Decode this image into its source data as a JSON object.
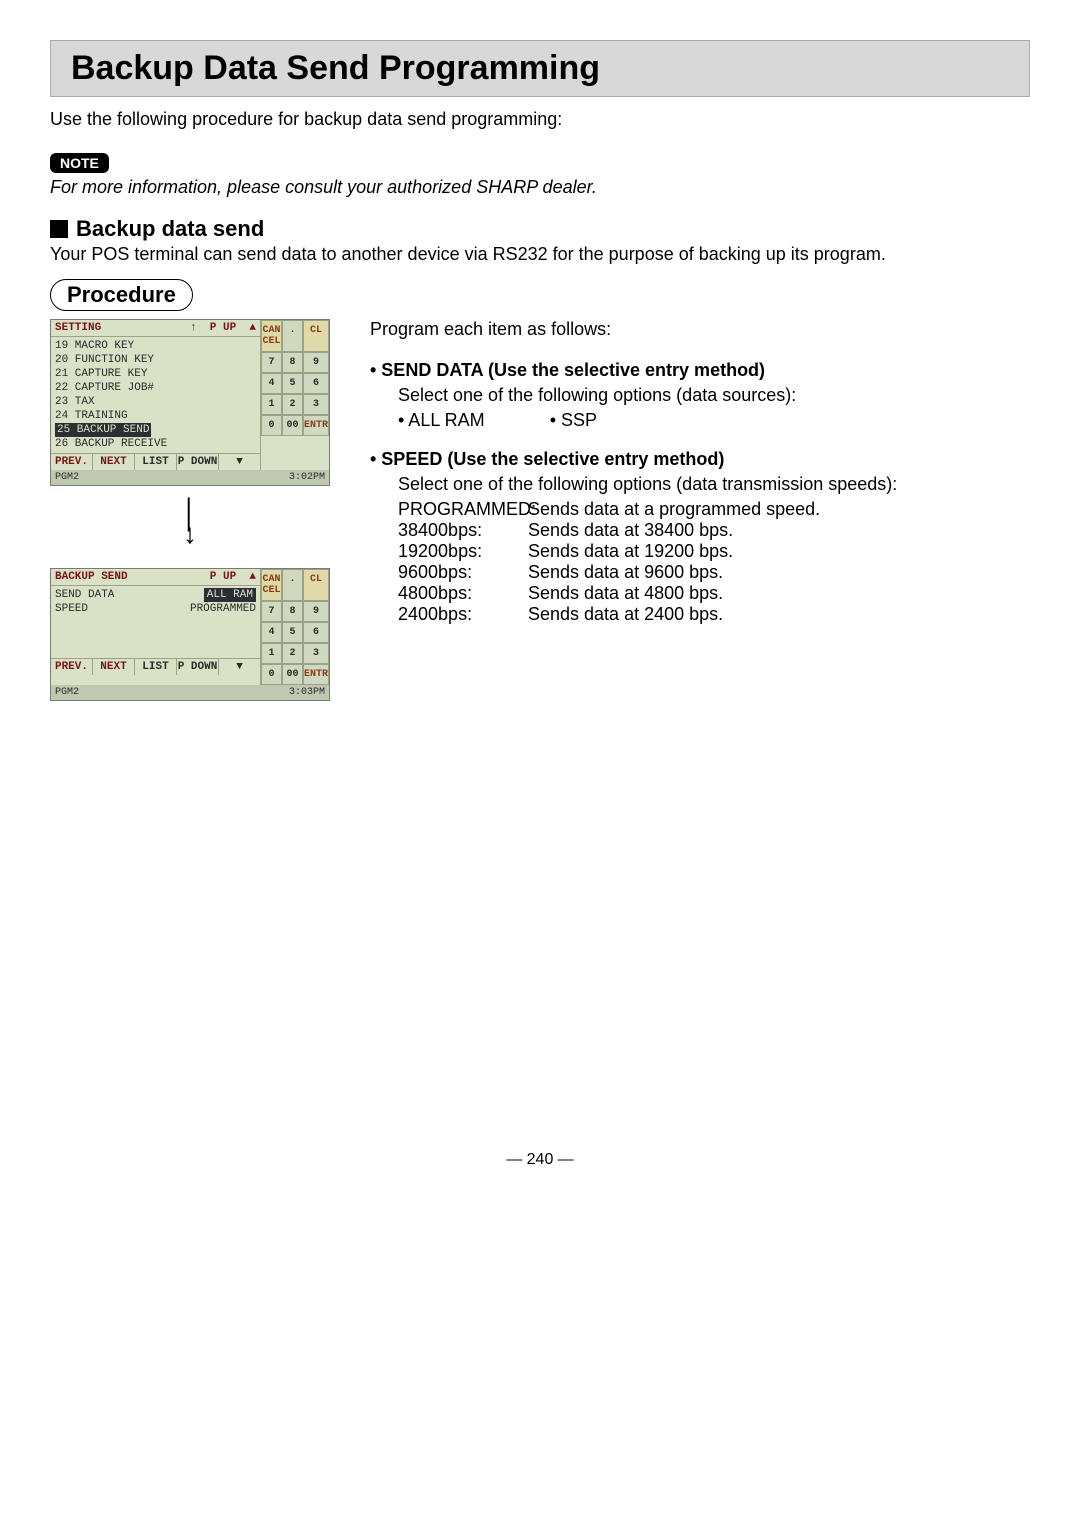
{
  "title": "Backup Data Send Programming",
  "intro": "Use the following procedure for backup data send programming:",
  "note_badge": "NOTE",
  "note_text": "For more information, please consult your authorized SHARP dealer.",
  "section": {
    "heading": "Backup data send",
    "text": "Your POS terminal can send data to another device via RS232 for the purpose of backing up its program."
  },
  "procedure_label": "Procedure",
  "pos1": {
    "title": "SETTING",
    "header_keys": [
      "↑",
      "P UP",
      "▲"
    ],
    "items": [
      "19 MACRO KEY",
      "20 FUNCTION KEY",
      "21 CAPTURE KEY",
      "22 CAPTURE JOB#",
      "23 TAX",
      "24 TRAINING"
    ],
    "selected": "25 BACKUP SEND",
    "after_sel": "26 BACKUP RECEIVE",
    "footer": [
      "PREV.",
      "NEXT",
      "LIST",
      "P DOWN",
      "▼"
    ],
    "status_left": "PGM2",
    "status_right": "3:02PM"
  },
  "keypad": {
    "rows": [
      [
        "CAN CEL",
        ".",
        "CL"
      ],
      [
        "7",
        "8",
        "9"
      ],
      [
        "4",
        "5",
        "6"
      ],
      [
        "1",
        "2",
        "3"
      ],
      [
        "0",
        "00",
        "ENTR"
      ]
    ]
  },
  "pos2": {
    "title": "BACKUP SEND",
    "header_keys": [
      "P UP",
      "▲"
    ],
    "fields": [
      {
        "label": "SEND DATA",
        "value": "ALL RAM",
        "selected": true
      },
      {
        "label": "SPEED",
        "value": "PROGRAMMED",
        "selected": false
      }
    ],
    "footer": [
      "PREV.",
      "NEXT",
      "LIST",
      "P DOWN",
      "▼"
    ],
    "status_left": "PGM2",
    "status_right": "3:03PM"
  },
  "right": {
    "lead": "Program each item as follows:",
    "send_data": {
      "heading": "• SEND DATA (Use the selective entry method)",
      "line": "Select one of the following options (data sources):",
      "opt1": "• ALL RAM",
      "opt2": "• SSP"
    },
    "speed": {
      "heading": "• SPEED (Use the selective entry method)",
      "line": "Select one of the following options (data transmission speeds):",
      "rows": [
        {
          "label": "PROGRAMMED:",
          "desc": "Sends data at a programmed speed."
        },
        {
          "label": "38400bps:",
          "desc": "Sends data at 38400 bps."
        },
        {
          "label": "19200bps:",
          "desc": "Sends data at 19200 bps."
        },
        {
          "label": "9600bps:",
          "desc": "Sends data at 9600 bps."
        },
        {
          "label": "4800bps:",
          "desc": "Sends data at 4800 bps."
        },
        {
          "label": "2400bps:",
          "desc": "Sends data at 2400 bps."
        }
      ]
    }
  },
  "page_number": "— 240 —"
}
